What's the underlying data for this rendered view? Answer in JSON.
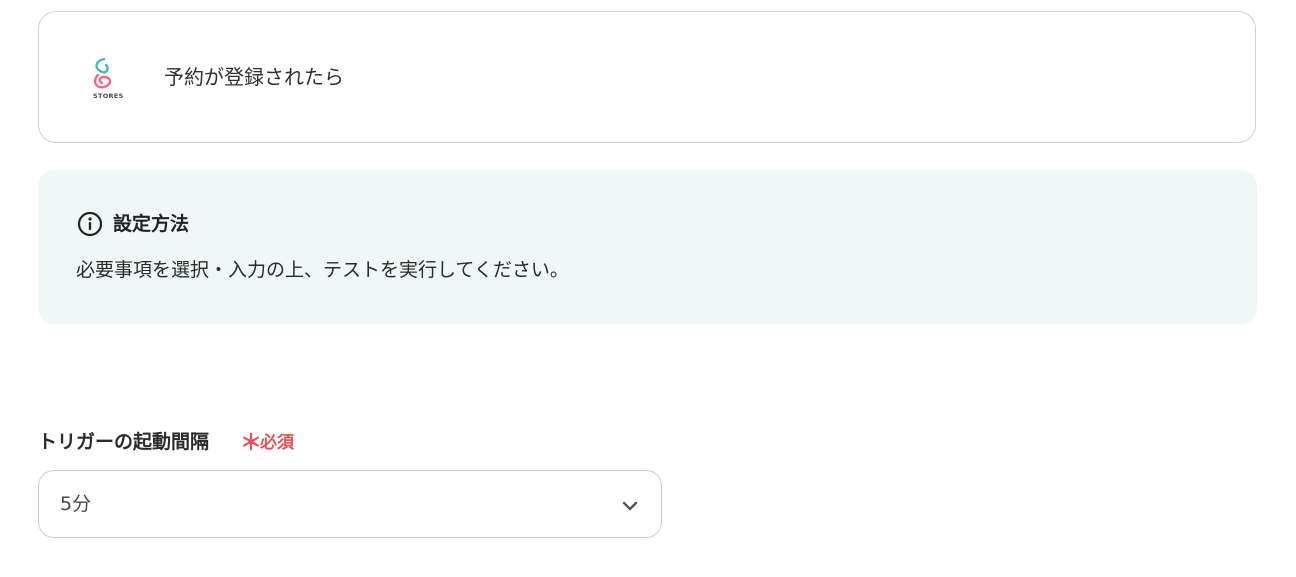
{
  "app_card": {
    "logo_icon": "stores-logo-icon",
    "logo_text": "STORES",
    "trigger_label": "予約が登録されたら"
  },
  "info": {
    "icon": "info-circle-icon",
    "title": "設定方法",
    "description": "必要事項を選択・入力の上、テストを実行してください。"
  },
  "trigger_interval": {
    "label": "トリガーの起動間隔",
    "required_mark": "＊",
    "required_text": "必須",
    "selected_value": "5分",
    "dropdown_icon": "chevron-down-icon"
  },
  "colors": {
    "info_bg": "#f0f8f7",
    "required": "#e8505b",
    "border": "#d2d2d2"
  }
}
